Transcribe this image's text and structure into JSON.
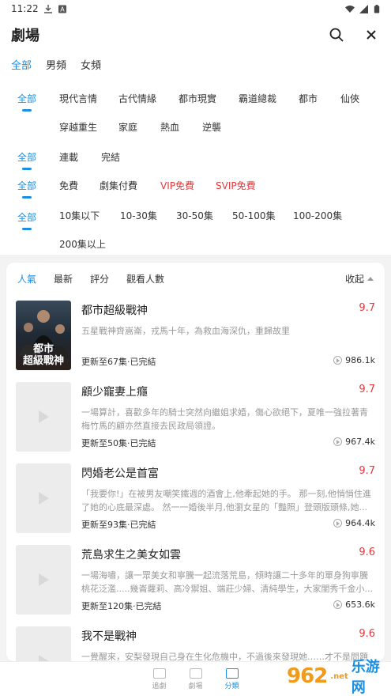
{
  "status_bar": {
    "time": "11:22"
  },
  "header": {
    "title": "劇場"
  },
  "gender_tabs": [
    {
      "label": "全部",
      "active": true
    },
    {
      "label": "男頻",
      "active": false
    },
    {
      "label": "女頻",
      "active": false
    }
  ],
  "filters": {
    "genre": [
      "全部",
      "現代言情",
      "古代情緣",
      "都市現實",
      "霸道總裁",
      "都市",
      "仙俠",
      "穿越重生",
      "家庭",
      "熱血",
      "逆襲"
    ],
    "status": [
      "全部",
      "連載",
      "完結"
    ],
    "pay": [
      "全部",
      "免費",
      "劇集付費",
      "VIP免費",
      "SVIP免費"
    ],
    "episodes": [
      "全部",
      "10集以下",
      "10-30集",
      "30-50集",
      "50-100集",
      "100-200集",
      "200集以上"
    ]
  },
  "sort_bar": {
    "options": [
      "人氣",
      "最新",
      "評分",
      "觀看人數"
    ],
    "collapse_label": "收起"
  },
  "items": [
    {
      "title": "都市超級戰神",
      "score": "9.7",
      "desc": "五星戰神齊嵩崙，戎馬十年，為救血海深仇，重歸故里",
      "update": "更新至67集·已完結",
      "views": "986.1k",
      "cover_text": "都市\n超級戰神"
    },
    {
      "title": "顧少寵妻上癮",
      "score": "9.7",
      "desc": "一場算計，喜歡多年的騎士突然向繼姐求婚，傷心欲絕下，夏唯一強拉著青梅竹馬的顧亦然直接去民政局領證。",
      "update": "更新至50集·已完結",
      "views": "967.4k"
    },
    {
      "title": "閃婚老公是首富",
      "score": "9.7",
      "desc": "「我要你!」在被男友嘲笑鐵週的酒會上,他牽起她的手。 那一刻,他悄悄住進了她的心底最深處。 然一一婚後半月,他瀏女星的「豔照」登頭版頭條,她...",
      "update": "更新至93集·已完結",
      "views": "964.4k"
    },
    {
      "title": "荒島求生之美女如雲",
      "score": "9.6",
      "desc": "一場海嘯，讓一眾美女和寧騰一起流落荒島，傾時讓二十多年的單身狗寧騰桃花泛濫.....幾崙蘿莉、高冷禦姐、端莊少婦、清純學生，大家閨秀千金小...",
      "update": "更新至120集·已完結",
      "views": "653.6k"
    },
    {
      "title": "我不是戰神",
      "score": "9.6",
      "desc": "一覺醒來，安梨發現自己身在生化危機中，不過後來發現她……才不是問題",
      "update": "",
      "views": ""
    }
  ],
  "bottom_nav": [
    {
      "label": "追劇",
      "active": false
    },
    {
      "label": "劇場",
      "active": false
    },
    {
      "label": "分類",
      "active": true
    }
  ],
  "watermark": {
    "logo": "962",
    "suffix": ".net",
    "text": "乐游网"
  }
}
